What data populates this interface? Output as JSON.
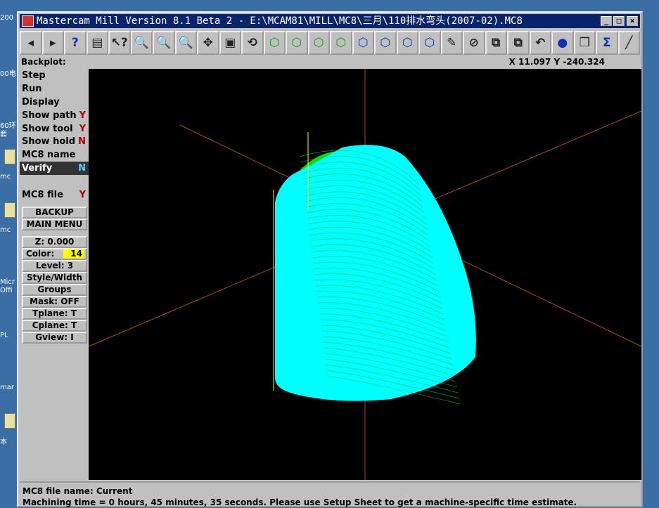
{
  "window": {
    "title": "Mastercam Mill Version 8.1 Beta 2 - E:\\MCAM81\\MILL\\MC8\\三月\\110排水弯头(2007-02).MC8",
    "min": "_",
    "max": "□",
    "close": "×"
  },
  "desktop": {
    "labels": [
      "200",
      "00电",
      "60环",
      "套",
      "mc",
      "mc",
      "Micr",
      "Offi",
      "PL",
      "mar",
      "本"
    ]
  },
  "toolbar": {
    "buttons": [
      {
        "icon": "arrow-left-icon",
        "glyph": "◂"
      },
      {
        "icon": "arrow-right-icon",
        "glyph": "▸"
      },
      {
        "icon": "help-icon",
        "glyph": "?"
      },
      {
        "icon": "file-cabinet-icon",
        "glyph": "▤"
      },
      {
        "icon": "analyze-icon",
        "glyph": "↖?"
      },
      {
        "icon": "zoom-window-icon",
        "glyph": "🔍"
      },
      {
        "icon": "zoom-fit-icon",
        "glyph": "🔍"
      },
      {
        "icon": "unzoom-icon",
        "glyph": "🔍"
      },
      {
        "icon": "pan-icon",
        "glyph": "✥"
      },
      {
        "icon": "select-screen-icon",
        "glyph": "▣"
      },
      {
        "icon": "rotate-view-icon",
        "glyph": "⟲"
      },
      {
        "icon": "cube-top-icon",
        "glyph": "⬡"
      },
      {
        "icon": "cube-front-icon",
        "glyph": "⬡"
      },
      {
        "icon": "cube-side-icon",
        "glyph": "⬡"
      },
      {
        "icon": "cube-iso-icon",
        "glyph": "⬡"
      },
      {
        "icon": "cube-blue-1-icon",
        "glyph": "⬡"
      },
      {
        "icon": "cube-blue-2-icon",
        "glyph": "⬡"
      },
      {
        "icon": "cube-blue-3-icon",
        "glyph": "⬡"
      },
      {
        "icon": "cube-blue-4-icon",
        "glyph": "⬡"
      },
      {
        "icon": "pencil-icon",
        "glyph": "✎"
      },
      {
        "icon": "no-delete-icon",
        "glyph": "⊘"
      },
      {
        "icon": "transform-icon",
        "glyph": "⧉"
      },
      {
        "icon": "transform-multi-icon",
        "glyph": "⧉"
      },
      {
        "icon": "undo-icon",
        "glyph": "↶"
      },
      {
        "icon": "shade-sphere-icon",
        "glyph": "●"
      },
      {
        "icon": "group-icon",
        "glyph": "❐"
      },
      {
        "icon": "sigma-icon",
        "glyph": "Σ"
      },
      {
        "icon": "line-icon",
        "glyph": "╱"
      }
    ]
  },
  "backplot_label": "Backplot:",
  "coords": "X 11.097  Y -240.324",
  "menu": [
    {
      "label": "Step",
      "value": ""
    },
    {
      "label": "Run",
      "value": ""
    },
    {
      "label": "Display",
      "value": ""
    },
    {
      "label": "Show path",
      "value": "Y"
    },
    {
      "label": "Show tool",
      "value": "Y"
    },
    {
      "label": "Show hold",
      "value": "N"
    },
    {
      "label": "MC8 name",
      "value": ""
    },
    {
      "label": "Verify",
      "value": "N",
      "selected": true
    },
    {
      "label": "",
      "value": ""
    },
    {
      "label": "MC8 file",
      "value": "Y"
    }
  ],
  "buttons": {
    "backup": "BACKUP",
    "main_menu": "MAIN MENU",
    "z": "Z:  0.000",
    "color_label": "Color:",
    "color_value": "14",
    "level": "Level:  3",
    "style": "Style/Width",
    "groups": "Groups",
    "mask": "Mask:  OFF",
    "tplane": "Tplane:  T",
    "cplane": "Cplane:  T",
    "gview": "Gview:  I"
  },
  "colors": {
    "toolpath": "#00ffff",
    "tool": "#00e000",
    "axes": "#a05010",
    "highlight": "#ffff00"
  },
  "status": {
    "line1": "MC8 file name: Current",
    "line2": "Machining time = 0 hours, 45 minutes, 35 seconds. Please use Setup Sheet to get a machine-specific time estimate."
  }
}
